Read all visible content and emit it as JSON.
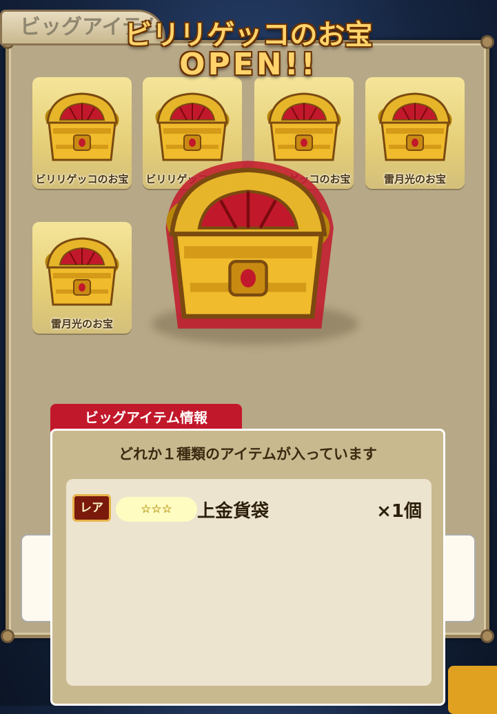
{
  "header": {
    "tab_label": "ビッグアイテム",
    "title_line1": "ビリリゲッコのお宝",
    "title_line2": "OPEN!!"
  },
  "cards": [
    {
      "label": "ビリリゲッコのお宝"
    },
    {
      "label": "ビリリゲッコのお宝"
    },
    {
      "label": "ビリリゲッコのお宝"
    },
    {
      "label": "雷月光のお宝"
    },
    {
      "label": "雷月光のお宝"
    }
  ],
  "info": {
    "tab_label": "ビッグアイテム情報",
    "message": "どれか１種類のアイテムが入っています",
    "item": {
      "rarity": "レア",
      "stars": "☆☆☆",
      "name": "上金貨袋",
      "quantity": "×1個"
    }
  },
  "colors": {
    "panel": "#b7a887",
    "gold": "#ffd36b",
    "tab_red": "#c2182b",
    "card_gold": "#f5e59a"
  }
}
